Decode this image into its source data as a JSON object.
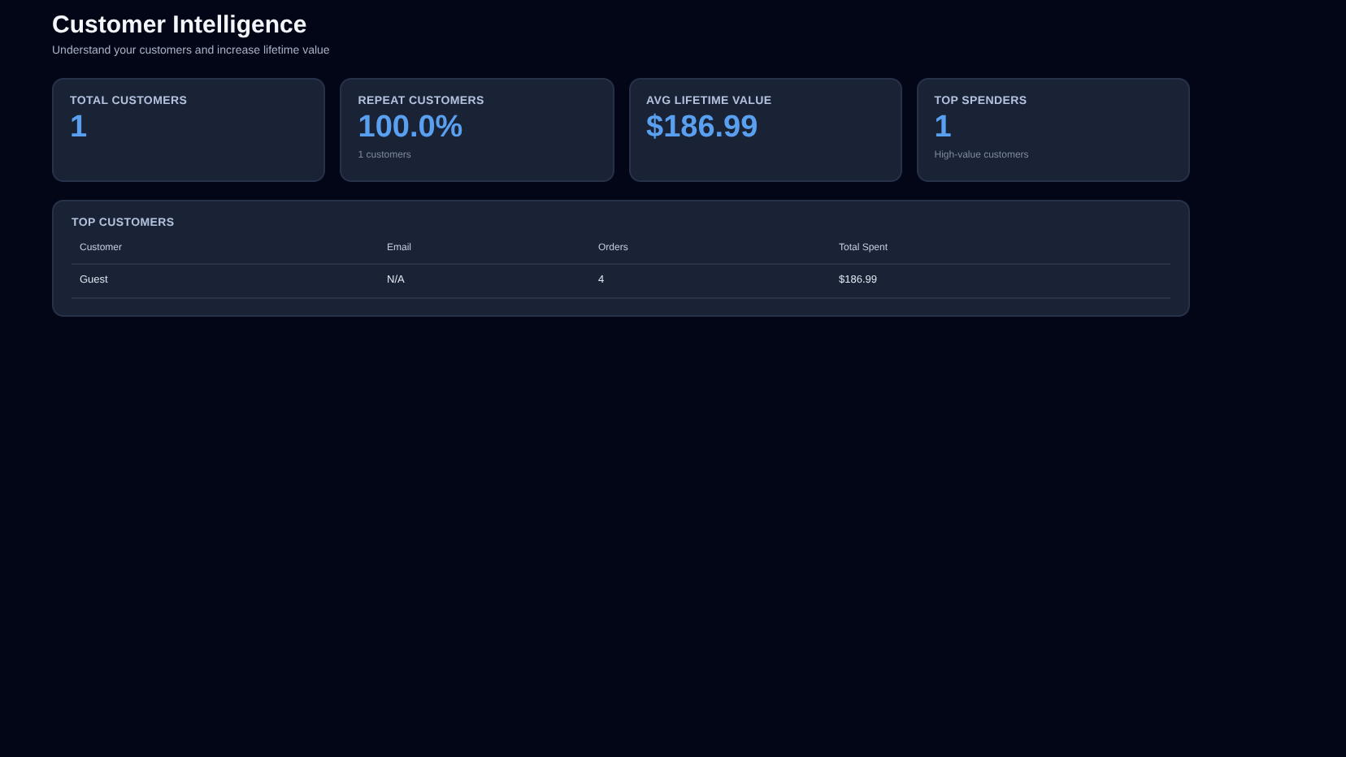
{
  "header": {
    "title": "Customer Intelligence",
    "subtitle": "Understand your customers and increase lifetime value"
  },
  "stats": [
    {
      "label": "TOTAL CUSTOMERS",
      "value": "1"
    },
    {
      "label": "REPEAT CUSTOMERS",
      "value": "100.0%",
      "note": "1 customers"
    },
    {
      "label": "AVG LIFETIME VALUE",
      "value": "$186.99"
    },
    {
      "label": "TOP SPENDERS",
      "value": "1",
      "note": "High-value customers"
    }
  ],
  "top_customers": {
    "title": "TOP CUSTOMERS",
    "columns": [
      "Customer",
      "Email",
      "Orders",
      "Total Spent"
    ],
    "rows": [
      [
        "Guest",
        "N/A",
        "4",
        "$186.99"
      ]
    ]
  }
}
